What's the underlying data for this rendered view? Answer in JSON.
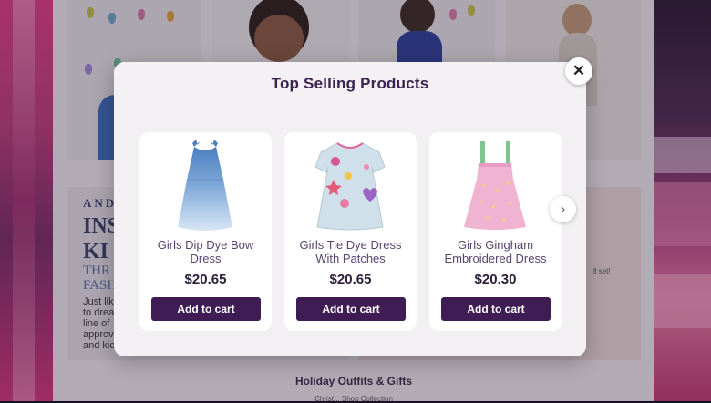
{
  "modal": {
    "title": "Top Selling Products",
    "close_icon": "close-icon",
    "next_icon": "chevron-right-icon",
    "products": [
      {
        "name": "Girls Dip Dye Bow Dress",
        "price": "$20.65",
        "button": "Add to cart",
        "image": "blue-dip-dye-dress"
      },
      {
        "name": "Girls Tie Dye Dress With Patches",
        "price": "$20.65",
        "button": "Add to cart",
        "image": "tie-dye-patch-dress"
      },
      {
        "name": "Girls Gingham Embroidered Dress",
        "price": "$20.30",
        "button": "Add to cart",
        "image": "pink-gingham-dress"
      }
    ]
  },
  "background": {
    "promo_heading_lines": [
      "AND",
      "INS",
      "KI",
      "THR",
      "FASH"
    ],
    "promo_body_lines": [
      "Just lik",
      "to drea",
      "line of",
      "approv",
      "and kic"
    ],
    "promo2_fragment": "ll set!",
    "footer_title": "Holiday Outfits & Gifts",
    "footer_sub": "Christ... Shop Collection"
  },
  "colors": {
    "button_bg": "#3f1d54",
    "title_color": "#3a2350",
    "modal_bg": "#ffffff"
  }
}
